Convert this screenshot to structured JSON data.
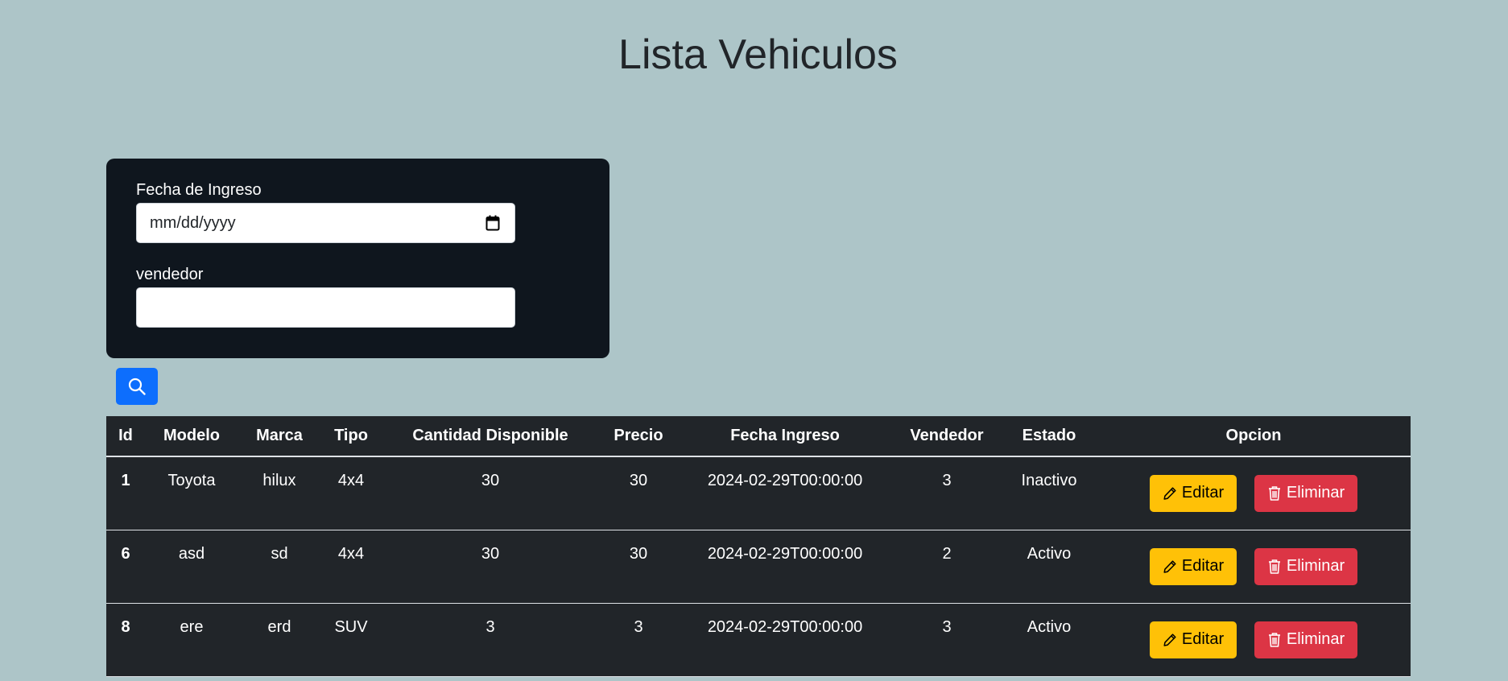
{
  "page": {
    "title": "Lista Vehiculos"
  },
  "filters": {
    "date_label": "Fecha de Ingreso",
    "date_placeholder": "mm/dd/yyyy",
    "vendor_label": "vendedor",
    "vendor_value": ""
  },
  "search": {
    "icon": "search-icon"
  },
  "table": {
    "headers": [
      "Id",
      "Modelo",
      "Marca",
      "Tipo",
      "Cantidad Disponible",
      "Precio",
      "Fecha Ingreso",
      "Vendedor",
      "Estado",
      "Opcion"
    ],
    "rows": [
      {
        "id": "1",
        "modelo": "Toyota",
        "marca": "hilux",
        "tipo": "4x4",
        "cantidad": "30",
        "precio": "30",
        "fecha": "2024-02-29T00:00:00",
        "vendedor": "3",
        "estado": "Inactivo"
      },
      {
        "id": "6",
        "modelo": "asd",
        "marca": "sd",
        "tipo": "4x4",
        "cantidad": "30",
        "precio": "30",
        "fecha": "2024-02-29T00:00:00",
        "vendedor": "2",
        "estado": "Activo"
      },
      {
        "id": "8",
        "modelo": "ere",
        "marca": "erd",
        "tipo": "SUV",
        "cantidad": "3",
        "precio": "3",
        "fecha": "2024-02-29T00:00:00",
        "vendedor": "3",
        "estado": "Activo"
      }
    ],
    "edit_label": "Editar",
    "delete_label": "Eliminar",
    "edit_icon": "pencil-icon",
    "delete_icon": "trash-icon"
  },
  "colors": {
    "background": "#adc5c8",
    "panel": "#0f161e",
    "table": "#212529",
    "primary": "#0d6efd",
    "warning": "#ffc107",
    "danger": "#dc3545"
  }
}
